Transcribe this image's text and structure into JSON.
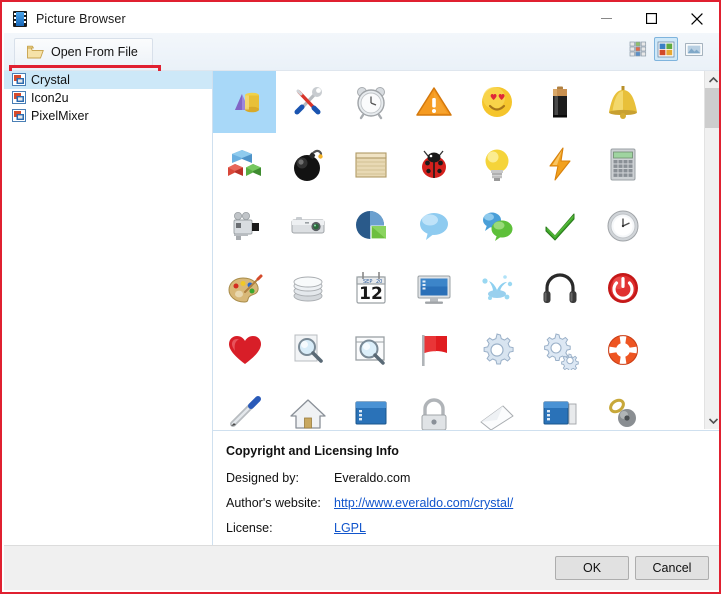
{
  "window": {
    "title": "Picture Browser",
    "title_icon": "film-strip-icon",
    "annotation_color": "#e02030",
    "controls": {
      "minimize": "minimize-icon",
      "maximize": "maximize-icon",
      "close": "close-icon"
    }
  },
  "toolbar": {
    "open_from_file_label": "Open From File",
    "open_from_file_icon": "open-folder-icon",
    "view_modes": [
      {
        "name": "small-icons-view",
        "selected": false
      },
      {
        "name": "medium-icons-view",
        "selected": true
      },
      {
        "name": "large-preview-view",
        "selected": false
      }
    ]
  },
  "sidebar": {
    "items": [
      {
        "label": "Crystal",
        "icon": "image-set-icon",
        "selected": true
      },
      {
        "label": "Icon2u",
        "icon": "image-set-icon",
        "selected": false
      },
      {
        "label": "PixelMixer",
        "icon": "image-set-icon",
        "selected": false
      }
    ]
  },
  "icon_grid": {
    "selected_index": 0,
    "columns": 7,
    "icons": [
      {
        "name": "3d-shapes-icon",
        "selected": true
      },
      {
        "name": "tools-icon",
        "selected": false
      },
      {
        "name": "alarm-clock-icon",
        "selected": false
      },
      {
        "name": "warning-triangle-icon",
        "selected": false
      },
      {
        "name": "smiley-heart-eyes-icon",
        "selected": false
      },
      {
        "name": "battery-icon",
        "selected": false
      },
      {
        "name": "bell-icon",
        "selected": false
      },
      {
        "name": "colored-cubes-icon",
        "selected": false
      },
      {
        "name": "bomb-icon",
        "selected": false
      },
      {
        "name": "package-box-icon",
        "selected": false
      },
      {
        "name": "ladybug-icon",
        "selected": false
      },
      {
        "name": "light-bulb-icon",
        "selected": false
      },
      {
        "name": "lightning-bolt-icon",
        "selected": false
      },
      {
        "name": "calculator-icon",
        "selected": false
      },
      {
        "name": "camcorder-icon",
        "selected": false
      },
      {
        "name": "photo-camera-icon",
        "selected": false
      },
      {
        "name": "pie-chart-icon",
        "selected": false
      },
      {
        "name": "speech-bubble-icon",
        "selected": false
      },
      {
        "name": "two-speech-bubbles-icon",
        "selected": false
      },
      {
        "name": "green-check-icon",
        "selected": false
      },
      {
        "name": "clock-icon",
        "selected": false
      },
      {
        "name": "paint-palette-icon",
        "selected": false
      },
      {
        "name": "database-icon",
        "selected": false
      },
      {
        "name": "calendar-icon",
        "selected": false
      },
      {
        "name": "monitor-icon",
        "selected": false
      },
      {
        "name": "water-splash-icon",
        "selected": false
      },
      {
        "name": "headphones-icon",
        "selected": false
      },
      {
        "name": "power-button-icon",
        "selected": false
      },
      {
        "name": "heart-icon",
        "selected": false
      },
      {
        "name": "zoom-document-icon",
        "selected": false
      },
      {
        "name": "zoom-window-icon",
        "selected": false
      },
      {
        "name": "red-flag-icon",
        "selected": false
      },
      {
        "name": "gear-icon",
        "selected": false
      },
      {
        "name": "two-gears-icon",
        "selected": false
      },
      {
        "name": "life-preserver-icon",
        "selected": false
      },
      {
        "name": "pen-icon",
        "selected": false
      },
      {
        "name": "home-icon",
        "selected": false
      },
      {
        "name": "blue-window-icon",
        "selected": false
      },
      {
        "name": "lock-icon",
        "selected": false
      },
      {
        "name": "envelope-icon",
        "selected": false
      },
      {
        "name": "window-sidebar-icon",
        "selected": false
      },
      {
        "name": "key-icon",
        "selected": false
      }
    ],
    "calendar_day": "12"
  },
  "info": {
    "title": "Copyright and Licensing Info",
    "rows": [
      {
        "key": "Designed by:",
        "value": "Everaldo.com",
        "link": false
      },
      {
        "key": "Author's website:",
        "value": "http://www.everaldo.com/crystal/",
        "link": true
      },
      {
        "key": "License:",
        "value": "LGPL",
        "link": true
      }
    ]
  },
  "footer": {
    "ok_label": "OK",
    "cancel_label": "Cancel"
  }
}
